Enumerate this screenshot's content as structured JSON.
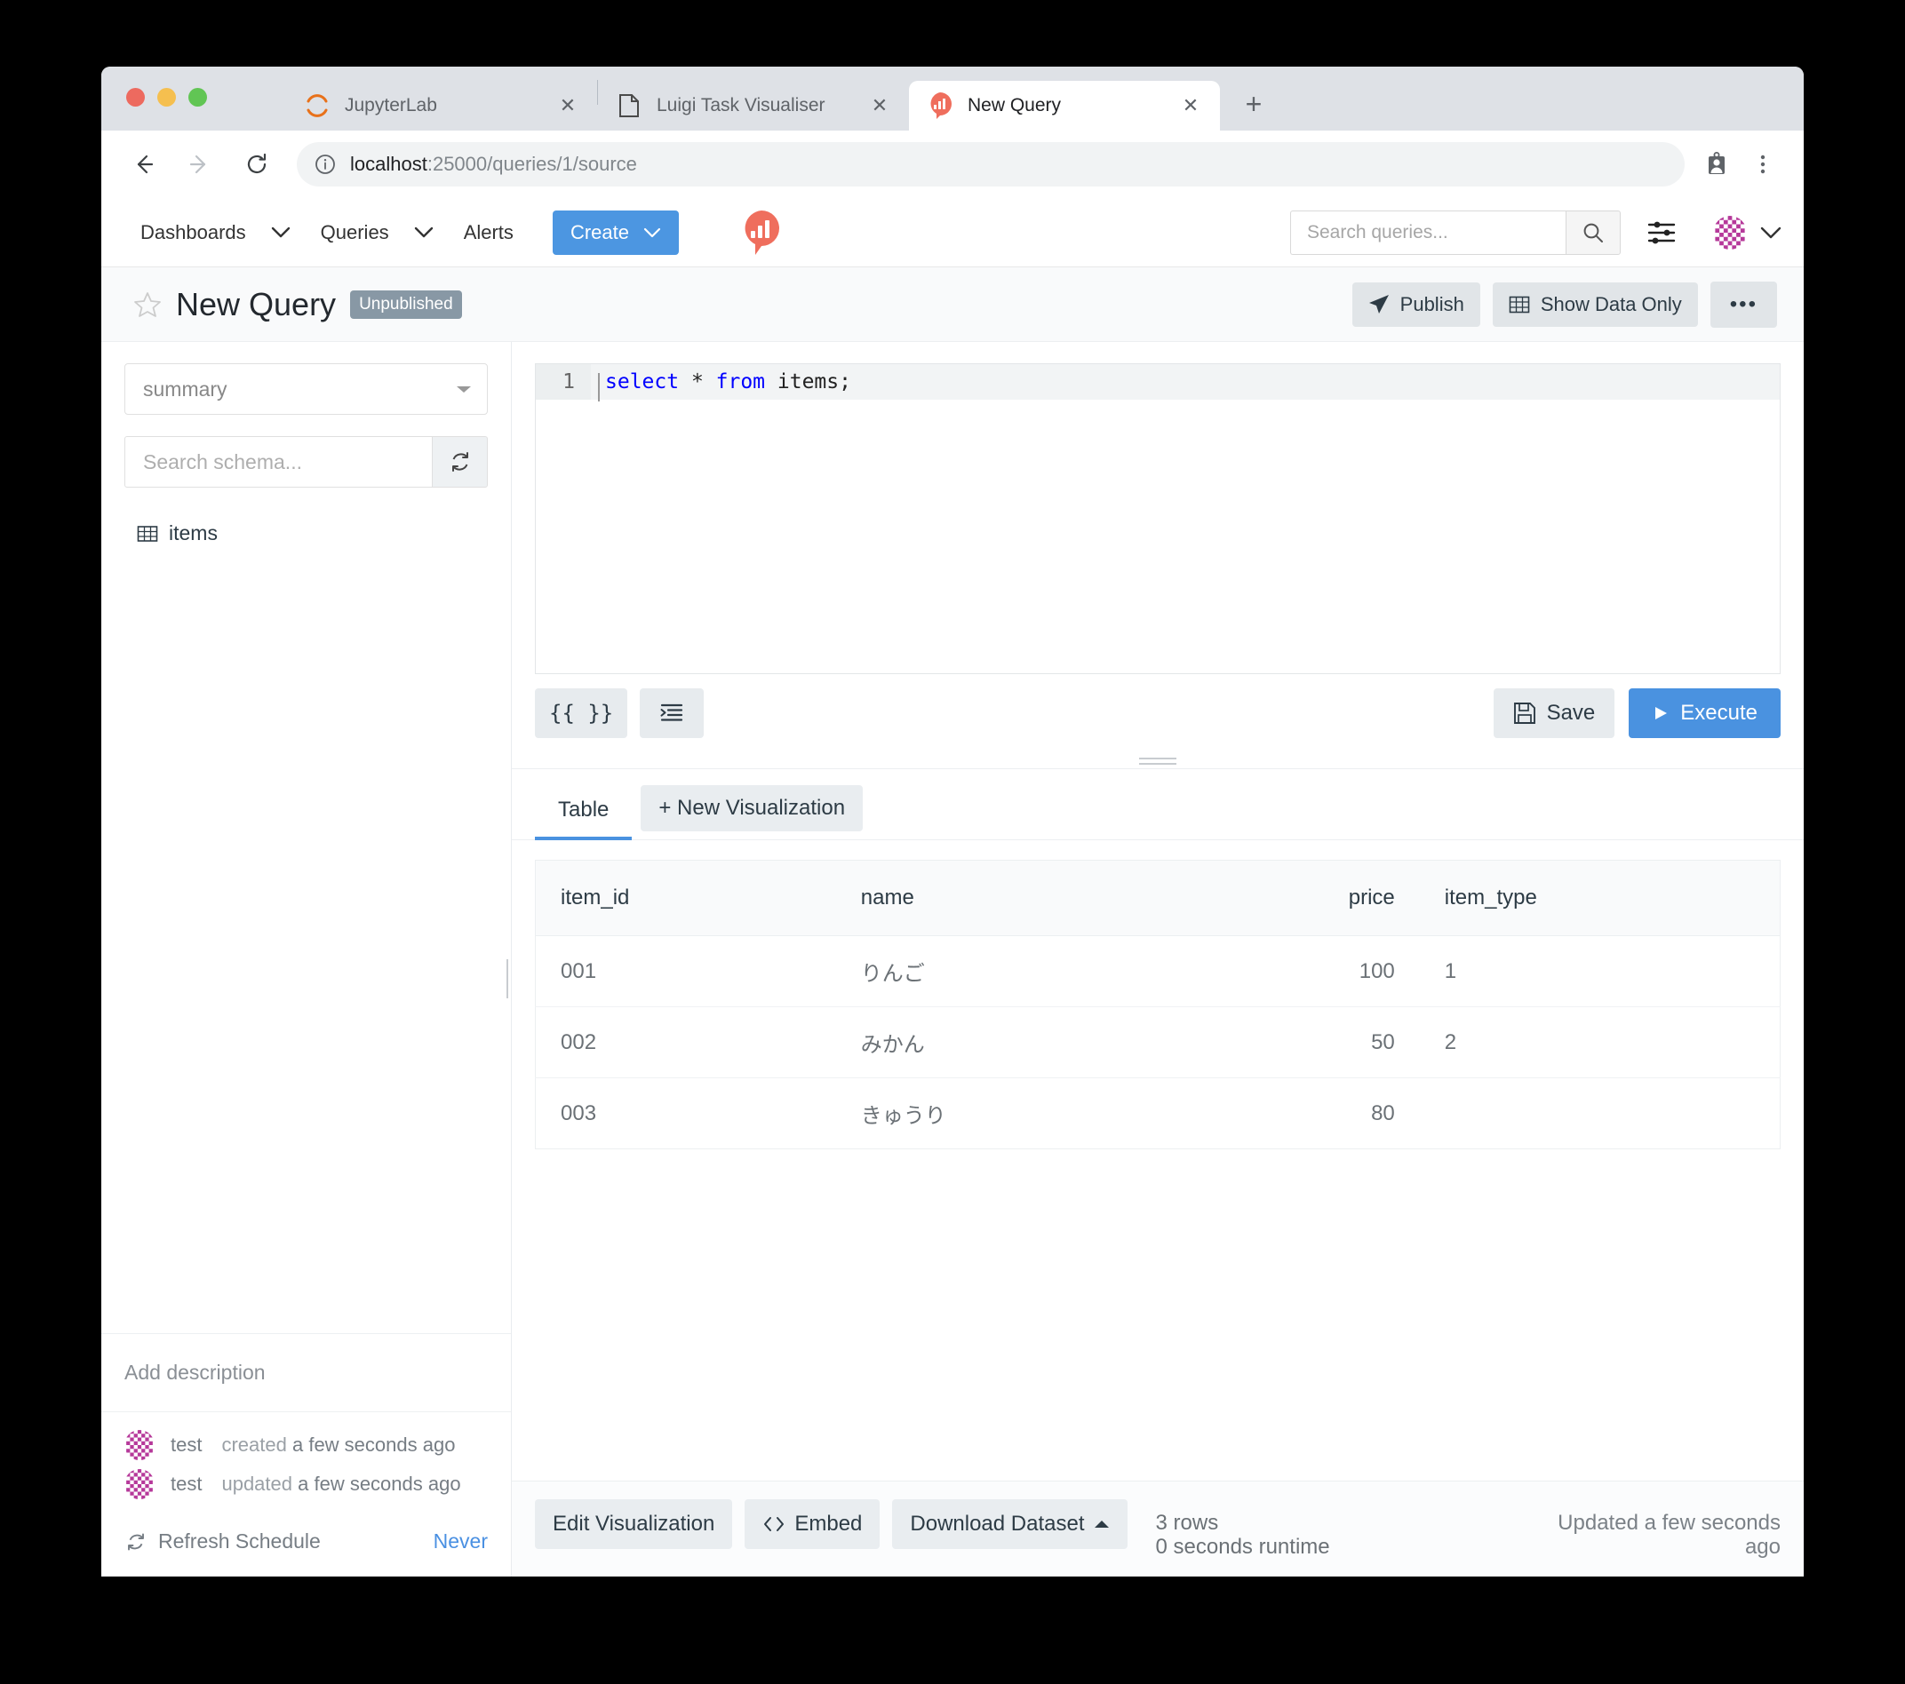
{
  "browser": {
    "tabs": [
      {
        "title": "JupyterLab",
        "favicon": "jupyter-icon",
        "active": false
      },
      {
        "title": "Luigi Task Visualiser",
        "favicon": "document-icon",
        "active": false
      },
      {
        "title": "New Query",
        "favicon": "redash-icon",
        "active": true
      }
    ],
    "new_tab_label": "+",
    "close_label": "✕",
    "url_host": "localhost",
    "url_rest": ":25000/queries/1/source",
    "back_icon": "back-arrow-icon",
    "forward_icon": "forward-arrow-icon",
    "reload_icon": "reload-icon",
    "info_icon": "info-circle-icon",
    "profile_icon": "profile-card-icon",
    "menu_icon": "kebab-menu-icon"
  },
  "nav": {
    "items": [
      {
        "label": "Dashboards",
        "has_caret": true
      },
      {
        "label": "Queries",
        "has_caret": true
      },
      {
        "label": "Alerts",
        "has_caret": false
      }
    ],
    "create_label": "Create",
    "logo": "redash-logo-icon",
    "search_placeholder": "Search queries...",
    "search_value": "",
    "search_icon": "magnifier-icon",
    "settings_icon": "sliders-icon",
    "avatar": "user-avatar-identicon",
    "avatar_caret": "chevron-down-icon"
  },
  "page_header": {
    "star_icon": "star-outline-icon",
    "title": "New Query",
    "badge": "Unpublished",
    "publish_label": "Publish",
    "publish_icon": "paper-plane-icon",
    "show_data_only_label": "Show Data Only",
    "show_data_only_icon": "table-grid-icon",
    "more_label": "•••"
  },
  "sidebar": {
    "datasource": "summary",
    "datasource_caret": "caret-down-icon",
    "schema_search_placeholder": "Search schema...",
    "schema_search_value": "",
    "refresh_icon": "refresh-schema-icon",
    "schema_items": [
      {
        "name": "items",
        "icon": "table-grid-icon"
      }
    ],
    "description_placeholder": "Add description",
    "history": [
      {
        "avatar": "user-avatar-identicon",
        "user": "test",
        "action": "created",
        "time": "a few seconds ago"
      },
      {
        "avatar": "user-avatar-identicon",
        "user": "test",
        "action": "updated",
        "time": "a few seconds ago"
      }
    ],
    "refresh_schedule_label": "Refresh Schedule",
    "refresh_schedule_icon": "refresh-icon",
    "refresh_schedule_value": "Never"
  },
  "editor": {
    "line_number": "1",
    "sql_tokens": [
      {
        "text": "select",
        "type": "keyword"
      },
      {
        "text": " * ",
        "type": "plain"
      },
      {
        "text": "from",
        "type": "keyword"
      },
      {
        "text": " items;",
        "type": "plain"
      }
    ],
    "sql_text": "select * from items;",
    "params_button": "{{ }}",
    "format_button": "format-sql-icon",
    "save_label": "Save",
    "save_icon": "floppy-disk-icon",
    "execute_label": "Execute",
    "execute_icon": "play-triangle-icon"
  },
  "results": {
    "tabs": [
      {
        "label": "Table",
        "active": true
      }
    ],
    "new_visualization_label": "+ New Visualization",
    "columns": [
      "item_id",
      "name",
      "price",
      "item_type"
    ],
    "column_align": [
      "left",
      "left",
      "right",
      "left"
    ],
    "rows": [
      [
        "001",
        "りんご",
        "100",
        "1"
      ],
      [
        "002",
        "みかん",
        "50",
        "2"
      ],
      [
        "003",
        "きゅうり",
        "80",
        ""
      ]
    ],
    "edit_visualization_label": "Edit Visualization",
    "embed_label": "Embed",
    "embed_icon": "code-brackets-icon",
    "download_label": "Download Dataset",
    "download_caret": "caret-up-icon",
    "row_count": "3 rows",
    "runtime": "0 seconds runtime",
    "updated": "Updated a few seconds ago"
  },
  "colors": {
    "accent_blue": "#4a92e0",
    "redash_coral": "#ef6e5d",
    "badge_gray": "#8898a5",
    "avatar_magenta": "#b6399a"
  }
}
